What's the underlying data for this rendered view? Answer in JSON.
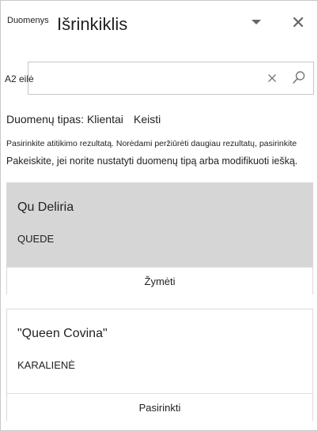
{
  "header": {
    "small_label": "Duomenys",
    "title": "Išrinkiklis"
  },
  "search": {
    "label": "A2 eilė",
    "value": "",
    "placeholder": ""
  },
  "data_type": {
    "label": "Duomenų tipas: Klientai",
    "change_label": "Keisti"
  },
  "instructions": {
    "line1": "Pasirinkite atitikimo rezultatą. Norėdami peržiūrėti daugiau rezultatų, pasirinkite",
    "line2": "Pakeiskite, jei norite nustatyti duomenų tipą arba modifikuoti iešką."
  },
  "results": [
    {
      "title": "Qu Deliria",
      "subtitle": "QUEDE",
      "action": "Žymėti"
    },
    {
      "title": "\"Queen Covina\"",
      "subtitle": "KARALIENĖ",
      "action": "Pasirinkti"
    }
  ],
  "colors": {
    "selected_card_bg": "#d6d6d6",
    "icon_gray": "#666666"
  }
}
